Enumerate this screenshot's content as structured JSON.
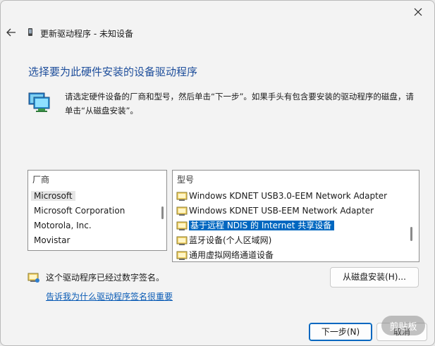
{
  "window": {
    "title": "更新驱动程序 - 未知设备"
  },
  "main": {
    "heading": "选择要为此硬件安装的设备驱动程序",
    "description": "请选定硬件设备的厂商和型号，然后单击“下一步”。如果手头有包含要安装的驱动程序的磁盘，请单击“从磁盘安装”。"
  },
  "manufacturer_list": {
    "header": "厂商",
    "items": [
      "Microsoft",
      "Microsoft Corporation",
      "Motorola, Inc.",
      "Movistar"
    ],
    "selected": "Microsoft"
  },
  "model_list": {
    "header": "型号",
    "items": [
      "Windows KDNET USB3.0-EEM Network Adapter",
      "Windows KDNET USB-EEM Network Adapter",
      "基于远程 NDIS 的 Internet 共享设备",
      "蓝牙设备(个人区域网)",
      "通用虚拟网络通道设备"
    ],
    "selected": "基于远程 NDIS 的 Internet 共享设备"
  },
  "signature": {
    "text": "这个驱动程序已经过数字签名。",
    "link": "告诉我为什么驱动程序签名很重要"
  },
  "buttons": {
    "have_disk": "从磁盘安装(H)...",
    "next": "下一步(N)",
    "cancel": "取消"
  },
  "watermark": {
    "text": "剪贴板"
  },
  "colors": {
    "accent": "#0067c0",
    "heading": "#1e4e9b",
    "link": "#0a5bb5"
  }
}
